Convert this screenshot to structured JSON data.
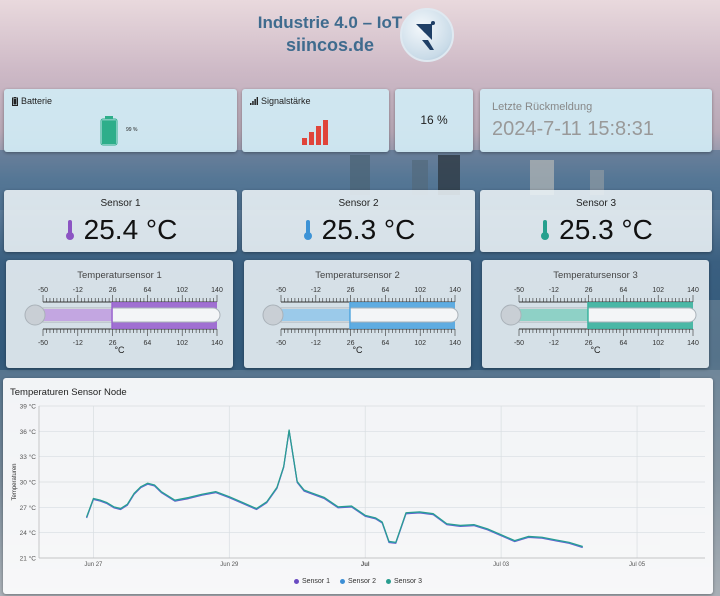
{
  "header": {
    "title_line1": "Industrie 4.0 – IoT",
    "title_line2": "siincos.de",
    "logo_icon": "satellite-dish-icon"
  },
  "battery": {
    "label": "Batterie",
    "value_text": "99 %",
    "level": 0.99,
    "color": "#2eae8a",
    "icon": "battery-icon"
  },
  "signal": {
    "label": "Signalstärke",
    "icon": "signal-bars-icon",
    "bar_color": "#e0443a",
    "bars_active": 4,
    "bars_total": 4
  },
  "signal_value": "16 %",
  "last_report": {
    "label": "Letzte Rückmeldung",
    "value": "2024-7-11 15:8:31"
  },
  "sensors": [
    {
      "title": "Sensor 1",
      "value": "25.4 °C",
      "icon": "thermometer-icon",
      "color": "#8c54c3"
    },
    {
      "title": "Sensor 2",
      "value": "25.3 °C",
      "icon": "thermometer-icon",
      "color": "#3d93d6"
    },
    {
      "title": "Sensor 3",
      "value": "25.3 °C",
      "icon": "thermometer-icon",
      "color": "#26a08e"
    }
  ],
  "gauges": [
    {
      "title": "Temperatursensor 1",
      "value": 25.4,
      "color": "#9a64cf",
      "unit": "°C"
    },
    {
      "title": "Temperatursensor 2",
      "value": 25.3,
      "color": "#52a6e0",
      "unit": "°C"
    },
    {
      "title": "Temperatursensor 3",
      "value": 25.3,
      "color": "#3bb39f",
      "unit": "°C"
    }
  ],
  "gauge_ticks": [
    "-50",
    "-12",
    "26",
    "64",
    "102",
    "140"
  ],
  "chart_data": {
    "type": "line",
    "title": "Temperaturen Sensor Node",
    "ylabel": "Temperaturen",
    "y_ticks": [
      "39 °C",
      "36 °C",
      "33 °C",
      "30 °C",
      "27 °C",
      "24 °C",
      "21 °C"
    ],
    "ylim": [
      21,
      39
    ],
    "x_ticks": [
      "Jun 27",
      "Jun 29",
      "Jul",
      "Jul 03",
      "Jul 05"
    ],
    "x_tick_days": [
      0,
      2,
      4,
      6,
      8
    ],
    "xlim": [
      -0.8,
      9
    ],
    "grid": true,
    "series": [
      {
        "name": "Sensor 1",
        "color": "#6a4bc2"
      },
      {
        "name": "Sensor 2",
        "color": "#3d8fd6"
      },
      {
        "name": "Sensor 3",
        "color": "#2a9d8f"
      }
    ],
    "x": [
      -0.1,
      0.0,
      0.1,
      0.2,
      0.3,
      0.4,
      0.5,
      0.6,
      0.7,
      0.8,
      0.9,
      1.0,
      1.2,
      1.4,
      1.6,
      1.8,
      2.0,
      2.2,
      2.4,
      2.55,
      2.7,
      2.8,
      2.88,
      3.0,
      3.1,
      3.2,
      3.4,
      3.6,
      3.8,
      4.0,
      4.15,
      4.25,
      4.35,
      4.45,
      4.6,
      4.8,
      5.0,
      5.2,
      5.4,
      5.6,
      5.8,
      6.0,
      6.2,
      6.4,
      6.6,
      6.8,
      7.0,
      7.2
    ],
    "values": [
      25.8,
      28.0,
      27.8,
      27.5,
      27.0,
      26.8,
      27.3,
      28.6,
      29.4,
      29.8,
      29.6,
      28.8,
      27.8,
      28.1,
      28.5,
      28.8,
      28.2,
      27.5,
      26.8,
      27.6,
      29.3,
      31.8,
      36.1,
      30.0,
      29.0,
      28.7,
      28.1,
      27.0,
      27.1,
      26.0,
      25.7,
      25.2,
      22.9,
      22.8,
      26.3,
      26.4,
      26.2,
      25.0,
      24.8,
      24.9,
      24.4,
      23.7,
      23.0,
      23.5,
      23.4,
      23.1,
      22.8,
      22.3
    ]
  },
  "chart_legend": [
    "Sensor 1",
    "Sensor 2",
    "Sensor 3"
  ]
}
